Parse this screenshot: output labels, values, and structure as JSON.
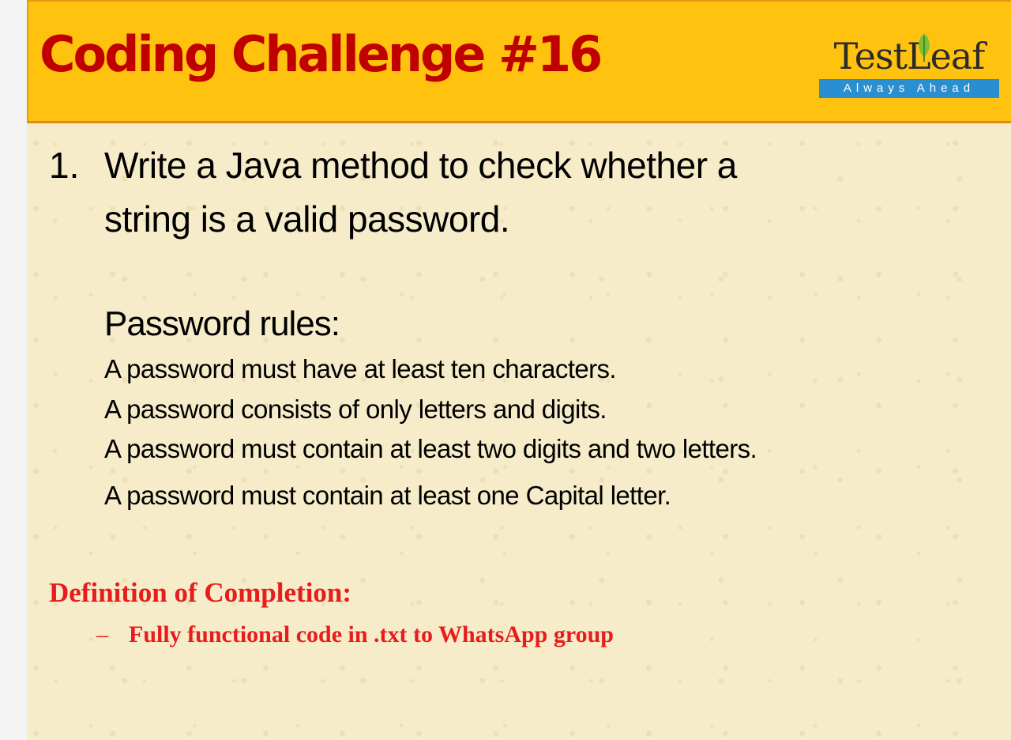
{
  "header": {
    "title": "Coding Challenge #16",
    "logo": {
      "name": "TestLeaf",
      "tagline": "Always Ahead",
      "icon": "leaf-icon",
      "colors": {
        "tagline_bg": "#2a8fd0",
        "leaf": "#7cbf3a"
      }
    }
  },
  "question": {
    "number": "1.",
    "line1": "Write a Java method to check whether a",
    "line2": "string  is a valid password."
  },
  "rules": {
    "heading": "Password rules:",
    "items": [
      "A password must have at least ten characters.",
      "A password consists of only letters and digits.",
      "A password must contain at least two digits and two letters.",
      "A password must contain at least one Capital letter."
    ]
  },
  "completion": {
    "heading": "Definition of Completion:",
    "dash": "–",
    "item": "Fully functional  code in .txt to WhatsApp group"
  },
  "colors": {
    "header_bg": "#ffc20e",
    "header_border": "#e08a1e",
    "title": "#c00000",
    "completion_text": "#e81c1c",
    "slide_bg": "#f6ecc9"
  }
}
